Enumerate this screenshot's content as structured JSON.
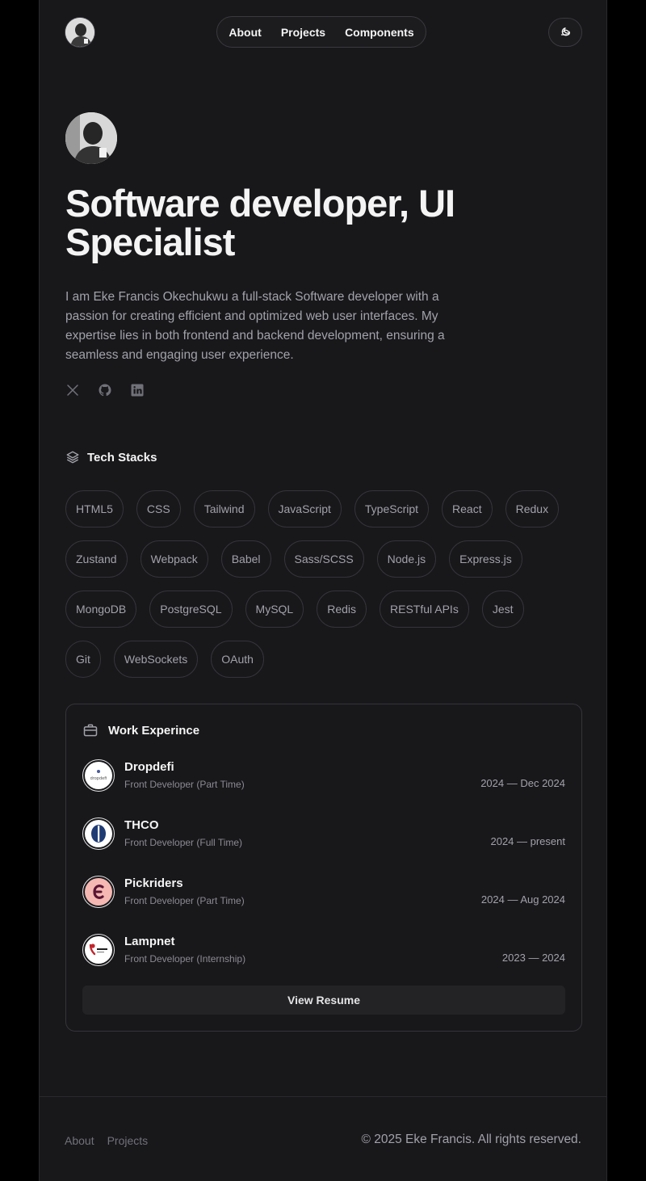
{
  "header": {
    "nav": [
      "About",
      "Projects",
      "Components"
    ],
    "theme_icon": "theme-toggle-icon"
  },
  "hero": {
    "title": "Software developer, UI Specialist",
    "intro": "I am Eke Francis Okechukwu a full-stack Software developer with a passion for creating efficient and optimized web user interfaces. My expertise lies in both frontend and backend development, ensuring a seamless and engaging user experience.",
    "socials": [
      "x-icon",
      "github-icon",
      "linkedin-icon"
    ]
  },
  "tech": {
    "heading": "Tech Stacks",
    "items": [
      "HTML5",
      "CSS",
      "Tailwind",
      "JavaScript",
      "TypeScript",
      "React",
      "Redux",
      "Zustand",
      "Webpack",
      "Babel",
      "Sass/SCSS",
      "Node.js",
      "Express.js",
      "MongoDB",
      "PostgreSQL",
      "MySQL",
      "Redis",
      "RESTful APIs",
      "Jest",
      "Git",
      "WebSockets",
      "OAuth"
    ]
  },
  "work": {
    "heading": "Work Experince",
    "jobs": [
      {
        "company": "Dropdefi",
        "role": "Front Developer (Part Time)",
        "dates": "2024 — Dec 2024",
        "logo_text": "dropdefi"
      },
      {
        "company": "THCO",
        "role": "Front Developer (Full Time)",
        "dates": "2024 — present"
      },
      {
        "company": "Pickriders",
        "role": "Front Developer (Part Time)",
        "dates": "2024 — Aug 2024"
      },
      {
        "company": "Lampnet",
        "role": "Front Developer (Internship)",
        "dates": "2023 — 2024"
      }
    ],
    "resume_label": "View Resume"
  },
  "footer": {
    "links": [
      "About",
      "Projects"
    ],
    "copyright": "© 2025 Eke Francis. All rights reserved."
  },
  "colors": {
    "page": "#18181b",
    "outer": "#000000",
    "text": "#f4f4f5",
    "muted": "#a1a1aa",
    "border": "#34343a"
  }
}
